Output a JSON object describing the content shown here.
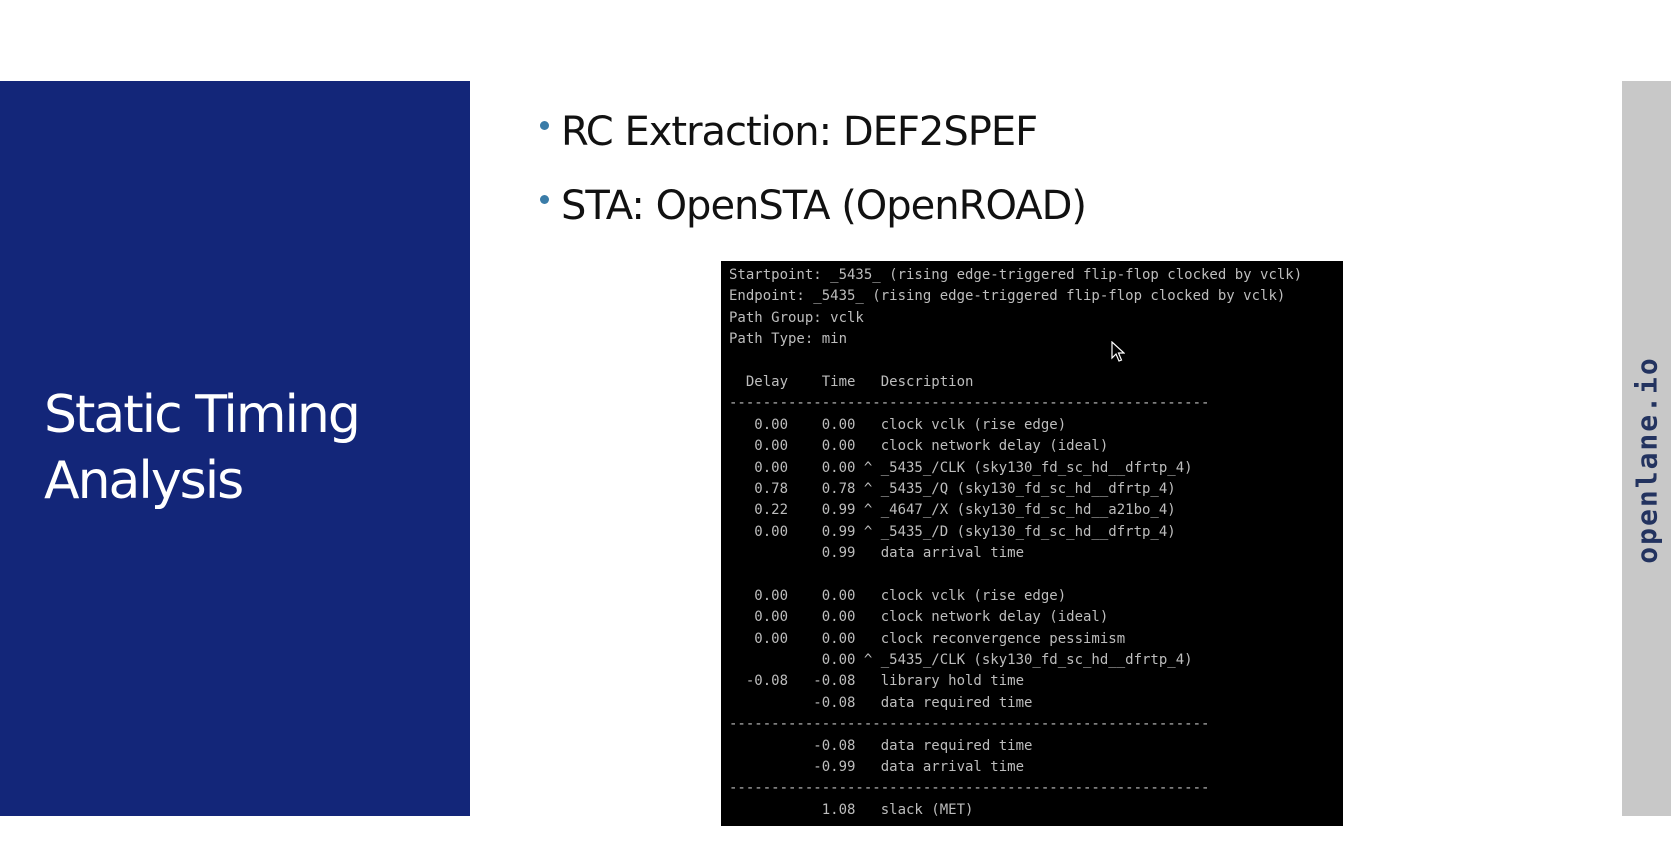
{
  "slide": {
    "title_lines": [
      "Static Timing",
      "Analysis"
    ],
    "bullets": [
      "RC Extraction: DEF2SPEF",
      "STA: OpenSTA (OpenROAD)"
    ],
    "brand": "openlane.io"
  },
  "terminal": {
    "lines": [
      "Startpoint: _5435_ (rising edge-triggered flip-flop clocked by vclk)",
      "Endpoint: _5435_ (rising edge-triggered flip-flop clocked by vclk)",
      "Path Group: vclk",
      "Path Type: min",
      "",
      "  Delay    Time   Description",
      "---------------------------------------------------------",
      "   0.00    0.00   clock vclk (rise edge)",
      "   0.00    0.00   clock network delay (ideal)",
      "   0.00    0.00 ^ _5435_/CLK (sky130_fd_sc_hd__dfrtp_4)",
      "   0.78    0.78 ^ _5435_/Q (sky130_fd_sc_hd__dfrtp_4)",
      "   0.22    0.99 ^ _4647_/X (sky130_fd_sc_hd__a21bo_4)",
      "   0.00    0.99 ^ _5435_/D (sky130_fd_sc_hd__dfrtp_4)",
      "           0.99   data arrival time",
      "",
      "   0.00    0.00   clock vclk (rise edge)",
      "   0.00    0.00   clock network delay (ideal)",
      "   0.00    0.00   clock reconvergence pessimism",
      "           0.00 ^ _5435_/CLK (sky130_fd_sc_hd__dfrtp_4)",
      "  -0.08   -0.08   library hold time",
      "          -0.08   data required time",
      "---------------------------------------------------------",
      "          -0.08   data required time",
      "          -0.99   data arrival time",
      "---------------------------------------------------------",
      "           1.08   slack (MET)"
    ]
  },
  "colors": {
    "panel_blue": "#132679",
    "bullet_dot": "#3a7ca8",
    "brand_text": "#23335f"
  }
}
